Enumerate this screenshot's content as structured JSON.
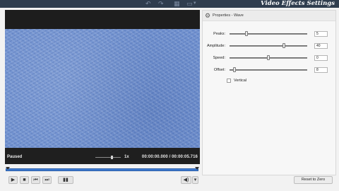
{
  "window": {
    "title": "Video Effects Settings",
    "toolbar_icons": [
      "undo-icon",
      "redo-icon",
      "grid-icon",
      "monitor-icon",
      "dropdown-arrow-icon"
    ]
  },
  "preview": {
    "status": "Paused",
    "speed": "1x",
    "time": "00:00:00.000  /  00:00:05.716"
  },
  "playback": {
    "play_glyph": "▶",
    "stop_glyph": "■",
    "prev_glyph": "⏮",
    "next_glyph": "⏭",
    "clip_glyph": "▮▮",
    "volume_glyph": "◀)",
    "volume_menu_glyph": "▾"
  },
  "panel": {
    "title": "Properties - Wave",
    "params": [
      {
        "label": "Peaks:",
        "value": "5",
        "fraction": 0.22
      },
      {
        "label": "Amplitude:",
        "value": "40",
        "fraction": 0.7
      },
      {
        "label": "Speed:",
        "value": "0",
        "fraction": 0.5
      },
      {
        "label": "Offset:",
        "value": "8",
        "fraction": 0.06
      }
    ],
    "vertical_label": "Vertical",
    "vertical_checked": false,
    "reset_label": "Reset to Zero"
  },
  "colors": {
    "titlebar": "#2f3d4e",
    "timeline": "#3f7bd1",
    "video": "#6f90cf"
  }
}
